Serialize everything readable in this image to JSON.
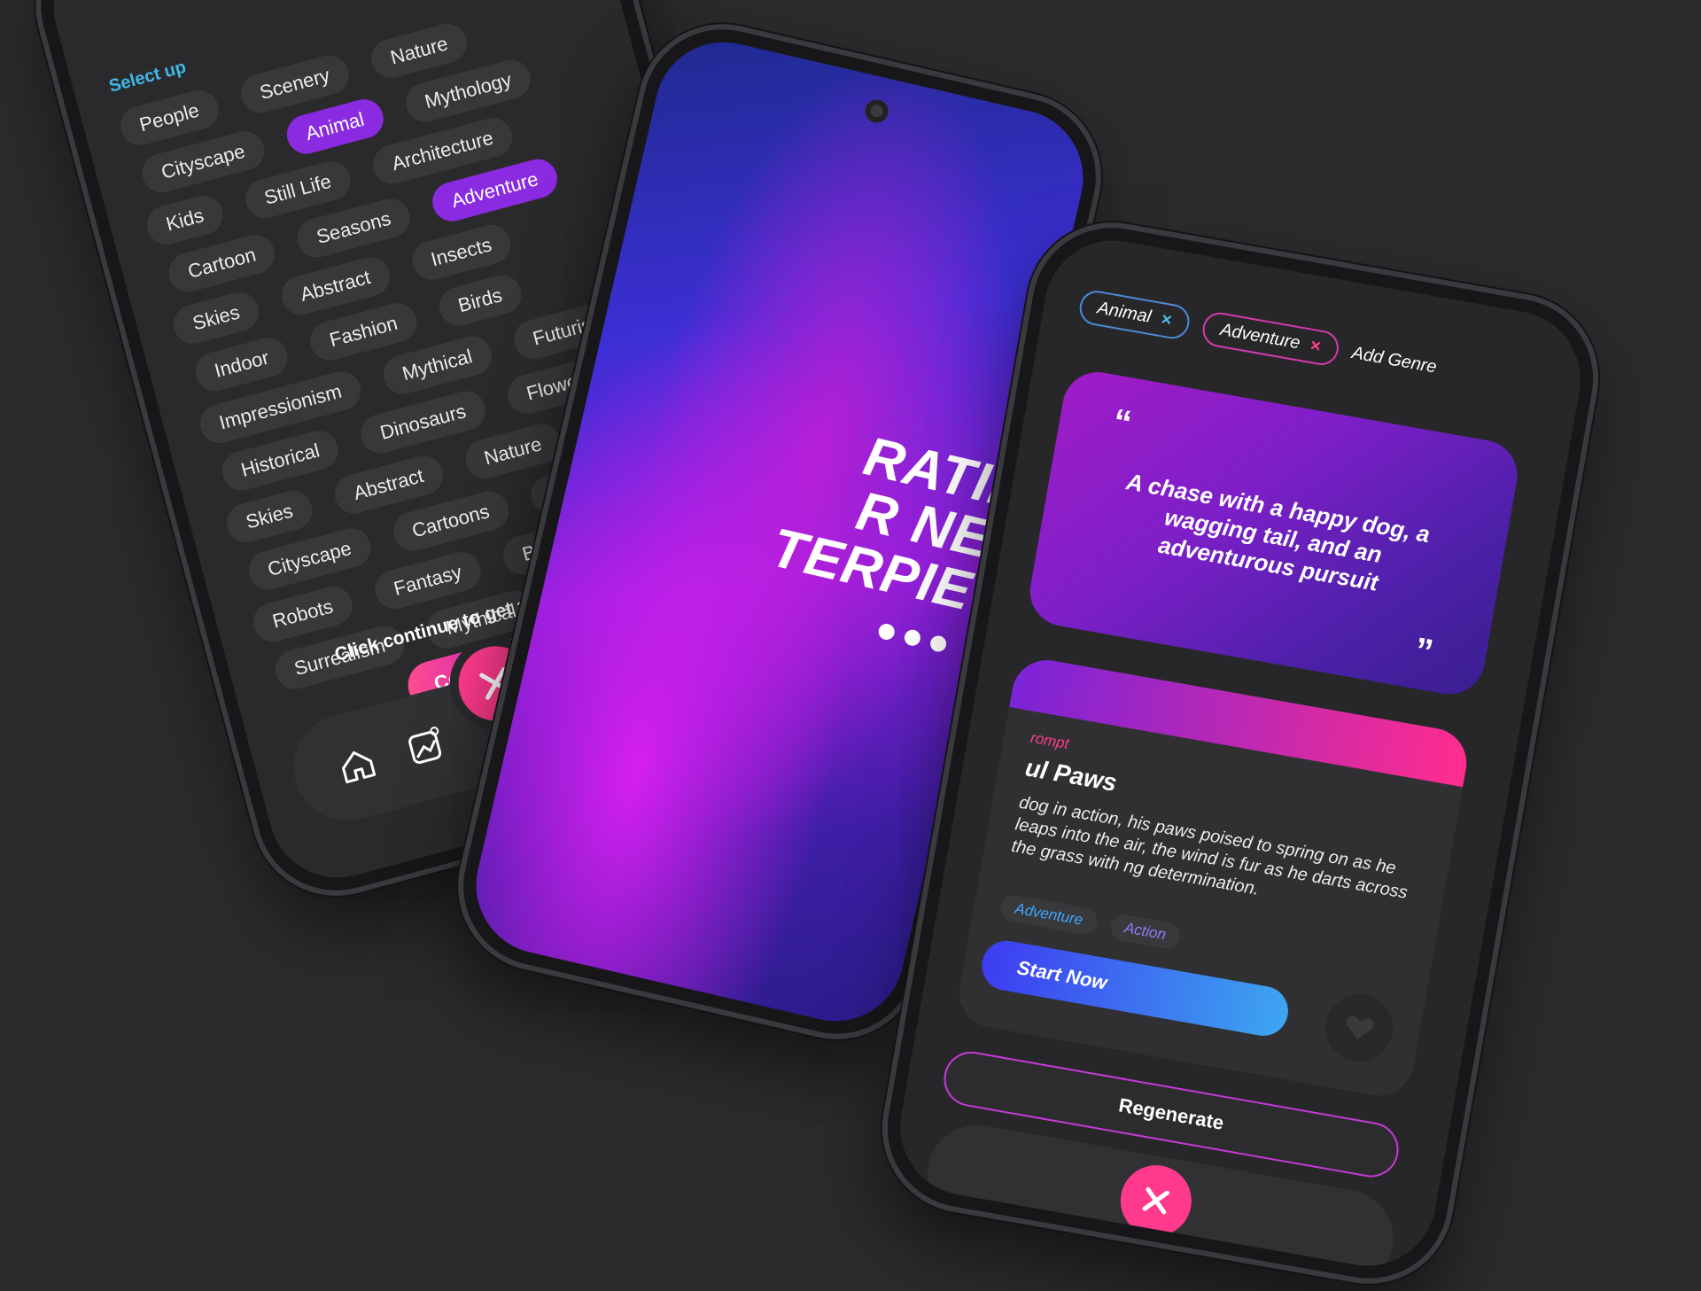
{
  "left_phone": {
    "select_hint": "Select up",
    "chip_rows": [
      [
        "People",
        "Scenery",
        "Nature"
      ],
      [
        "Cityscape",
        "Animal",
        "Mythology"
      ],
      [
        "Kids",
        "Still Life",
        "Architecture"
      ],
      [
        "Cartoon",
        "Seasons",
        "Adventure"
      ],
      [
        "Skies",
        "Abstract",
        "Insects"
      ],
      [
        "Indoor",
        "Fashion",
        "Birds"
      ],
      [
        "Impressionism",
        "Mythical",
        "Futuristic"
      ],
      [
        "Historical",
        "Dinosaurs",
        "Flowers"
      ],
      [
        "Skies",
        "Abstract",
        "Nature"
      ],
      [
        "Cityscape",
        "Cartoons",
        "Insects"
      ],
      [
        "Robots",
        "Fantasy",
        "Birds"
      ],
      [
        "Surrealism",
        "Mythical"
      ]
    ],
    "selected_chips": [
      "Animal",
      "Adventure"
    ],
    "continue_hint": "Click continue to get a prompt",
    "continue_label": "Continue",
    "nav": {
      "icons": [
        "home-icon",
        "gallery-icon",
        "close-icon",
        "chat-icon",
        "avatar"
      ]
    }
  },
  "middle_phone": {
    "splash_lines": [
      "RATING",
      "R NEXT",
      "TERPIECE"
    ],
    "dots_count": 3
  },
  "right_phone": {
    "tags": [
      {
        "label": "Animal",
        "remove": "×"
      },
      {
        "label": "Adventure",
        "remove": "×"
      }
    ],
    "add_genre": "Add Genre",
    "quote_open": "“",
    "quote_close": "”",
    "quote_text": "A chase with a happy dog, a wagging tail, and an adventurous pursuit",
    "prompt_label": "rompt",
    "prompt_title": "ul Paws",
    "prompt_desc": "dog in action, his paws poised to spring on as he leaps into the air, the wind is fur as he darts across the grass with ng determination.",
    "genre_tags": [
      "Adventure",
      "Action"
    ],
    "start_label": "Start Now",
    "regenerate_label": "Regenerate"
  },
  "colors": {
    "background": "#2b2b2d",
    "accent_pink": "#ff3a8c",
    "accent_purple": "#8a2be2",
    "accent_blue": "#3da6f0"
  }
}
